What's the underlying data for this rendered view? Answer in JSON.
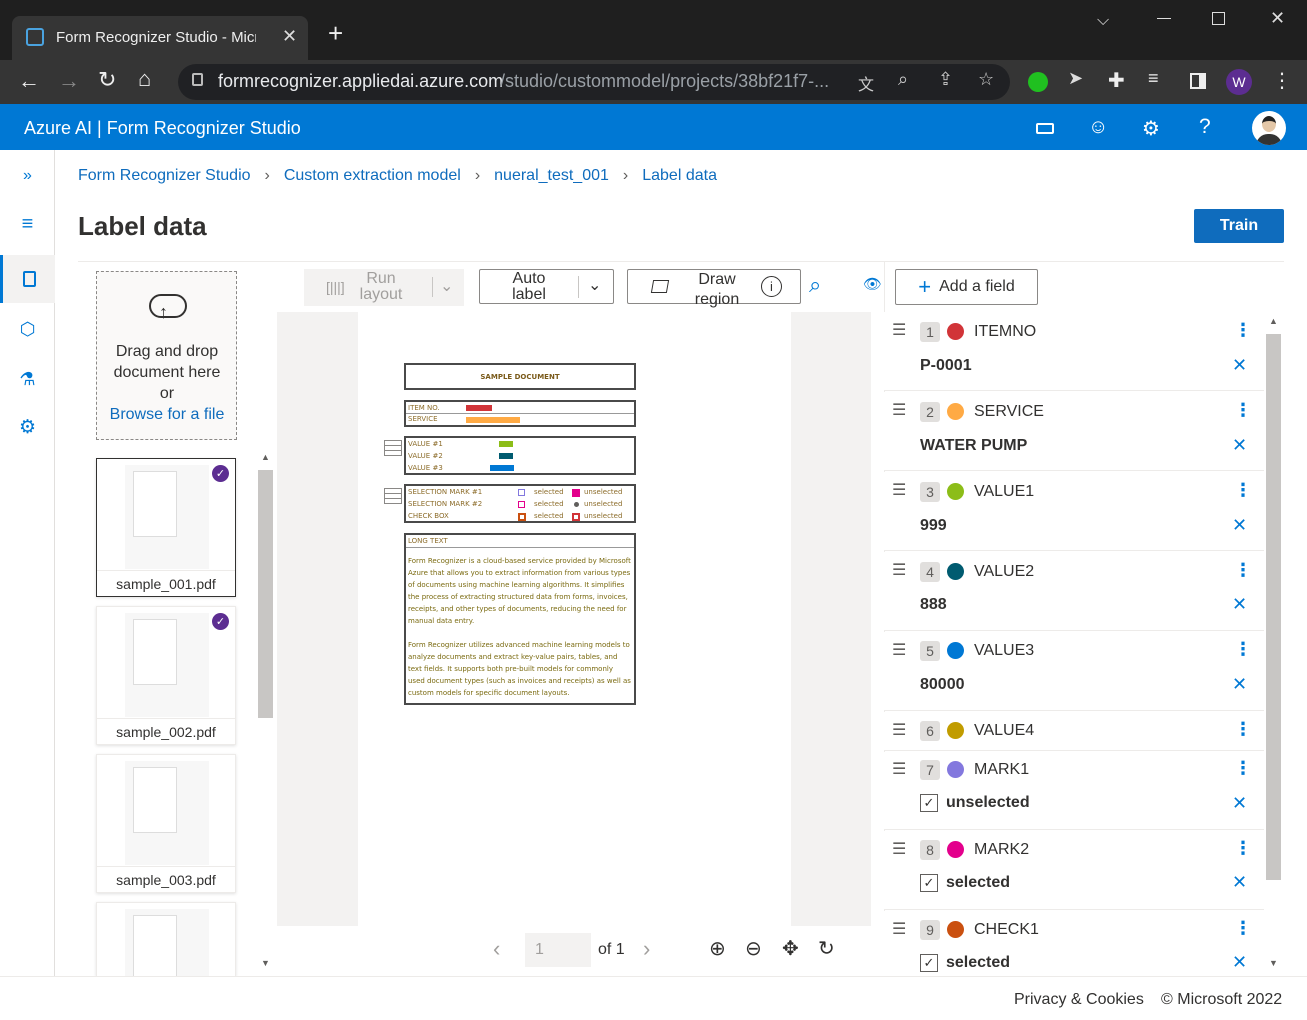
{
  "browser": {
    "tab_title": "Form Recognizer Studio - Micro",
    "new_tab": "+",
    "url_domain": "formrecognizer.appliedai.azure.com",
    "url_path": "/studio/custommodel/projects/38bf21f7-...",
    "profile_initial": "W",
    "window_controls": [
      "chevron-down-icon",
      "minimize-icon",
      "maximize-icon",
      "close-icon"
    ]
  },
  "app": {
    "title": "Azure AI | Form Recognizer Studio",
    "header_icons": [
      "keyboard-icon",
      "smiley-icon",
      "gear-icon",
      "help-icon",
      "avatar"
    ]
  },
  "nav": {
    "icons": [
      "expand-icon",
      "hamburger-icon",
      "document-icon",
      "cube-icon",
      "flask-icon",
      "gear-icon"
    ]
  },
  "breadcrumb": [
    "Form Recognizer Studio",
    "Custom extraction model",
    "nueral_test_001",
    "Label data"
  ],
  "page": {
    "title": "Label data",
    "train_button": "Train"
  },
  "upload": {
    "line1": "Drag and drop",
    "line2": "document here",
    "line3": "or",
    "link": "Browse for a file"
  },
  "files": [
    {
      "name": "sample_001.pdf",
      "labeled": true
    },
    {
      "name": "sample_002.pdf",
      "labeled": true
    },
    {
      "name": "sample_003.pdf",
      "labeled": false
    },
    {
      "name": "",
      "labeled": false
    }
  ],
  "toolbar": {
    "run_layout": "Run layout",
    "auto_label": "Auto label",
    "draw_region": "Draw region",
    "add_field": "Add a field"
  },
  "document": {
    "header": "SAMPLE DOCUMENT",
    "item_no_label": "ITEM NO.",
    "service_label": "SERVICE",
    "value1_label": "VALUE #1",
    "value2_label": "VALUE #2",
    "value3_label": "VALUE #3",
    "mark1_label": "SELECTION MARK #1",
    "mark2_label": "SELECTION MARK #2",
    "check_label": "CHECK BOX",
    "selected": "selected",
    "unselected": "unselected",
    "long_text_label": "LONG TEXT",
    "para1": "Form Recognizer is a cloud-based service provided by Microsoft Azure that allows you to extract information from various types of documents using machine learning algorithms. It simplifies the process of extracting structured data from forms, invoices, receipts, and other types of documents, reducing the need for manual data entry.",
    "para2": "Form Recognizer utilizes advanced machine learning models to analyze documents and extract key-value pairs, tables, and text fields. It supports both pre-built models for commonly used document types (such as invoices and receipts) as well as custom models for specific document layouts."
  },
  "pager": {
    "page_value": "1",
    "of_label": "of 1"
  },
  "fields": [
    {
      "num": "1",
      "name": "ITEMNO",
      "color": "#d13438",
      "value": "P-0001",
      "checkbox": false
    },
    {
      "num": "2",
      "name": "SERVICE",
      "color": "#ffaa44",
      "value": "WATER PUMP",
      "checkbox": false
    },
    {
      "num": "3",
      "name": "VALUE1",
      "color": "#8cbd18",
      "value": "999",
      "checkbox": false
    },
    {
      "num": "4",
      "name": "VALUE2",
      "color": "#005b70",
      "value": "888",
      "checkbox": false
    },
    {
      "num": "5",
      "name": "VALUE3",
      "color": "#0078d4",
      "value": "80000",
      "checkbox": false
    },
    {
      "num": "6",
      "name": "VALUE4",
      "color": "#c19c00",
      "value": "",
      "checkbox": false
    },
    {
      "num": "7",
      "name": "MARK1",
      "color": "#8378de",
      "value": "unselected",
      "checkbox": true
    },
    {
      "num": "8",
      "name": "MARK2",
      "color": "#e3008c",
      "value": "selected",
      "checkbox": true
    },
    {
      "num": "9",
      "name": "CHECK1",
      "color": "#ca5010",
      "value": "selected",
      "checkbox": true
    }
  ],
  "footer": {
    "privacy": "Privacy & Cookies",
    "copyright": "© Microsoft 2022"
  }
}
